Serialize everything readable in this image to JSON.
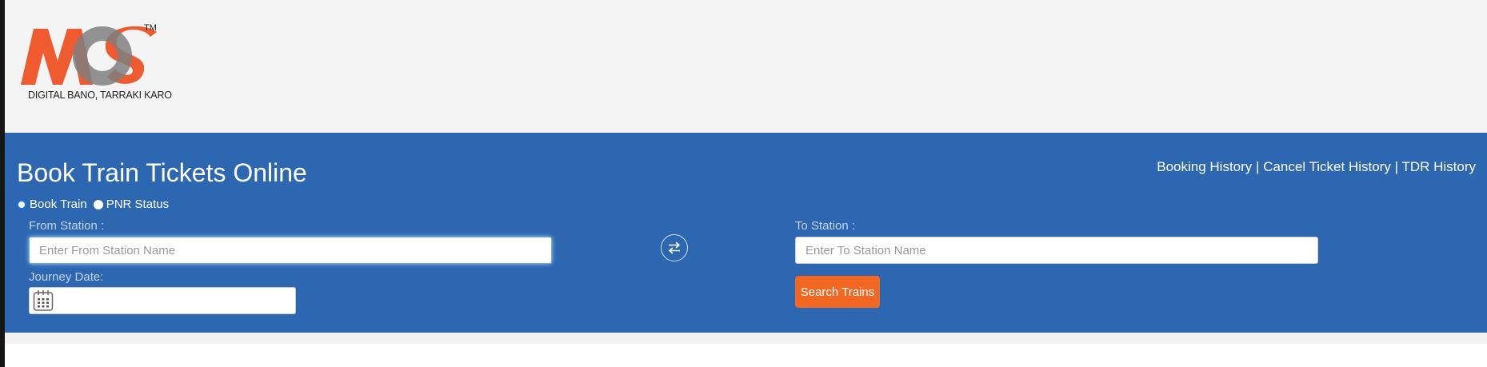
{
  "logo": {
    "text": "MOS",
    "trademark": "TM",
    "tagline": "DIGITAL BANO, TARRAKI KARO"
  },
  "page_title": "Book Train Tickets Online",
  "nav_links": {
    "booking_history": "Booking History",
    "separator": "|",
    "cancel_history": "Cancel Ticket History",
    "tdr_history": "TDR History"
  },
  "mode": {
    "options": [
      "Book Train",
      "PNR Status"
    ],
    "selected": "Book Train"
  },
  "form": {
    "from_label": "From Station :",
    "from_placeholder": "Enter From Station Name",
    "to_label": "To Station :",
    "to_placeholder": "Enter To Station Name",
    "date_label": "Journey Date:",
    "date_value": "",
    "search_label": "Search Trains"
  },
  "colors": {
    "band": "#2d66b1",
    "accent": "#f26722",
    "logo_orange": "#ef5a2f",
    "logo_gray": "#8f8f8f"
  }
}
